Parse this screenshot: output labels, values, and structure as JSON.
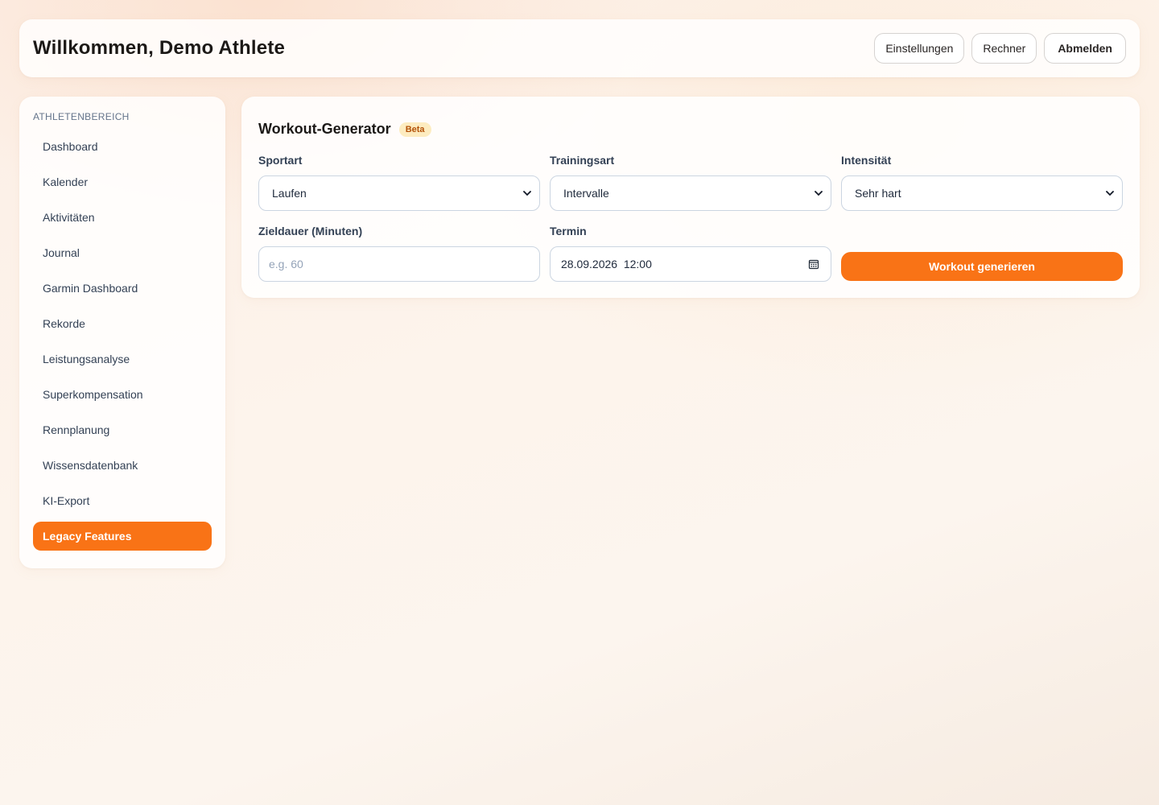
{
  "header": {
    "title": "Willkommen, Demo Athlete",
    "buttons": {
      "settings": "Einstellungen",
      "calculator": "Rechner",
      "logout": "Abmelden"
    }
  },
  "sidebar": {
    "heading": "ATHLETENBEREICH",
    "items": [
      {
        "label": "Dashboard"
      },
      {
        "label": "Kalender"
      },
      {
        "label": "Aktivitäten"
      },
      {
        "label": "Journal"
      },
      {
        "label": "Garmin Dashboard"
      },
      {
        "label": "Rekorde"
      },
      {
        "label": "Leistungsanalyse"
      },
      {
        "label": "Superkompensation"
      },
      {
        "label": "Rennplanung"
      },
      {
        "label": "Wissensdatenbank"
      },
      {
        "label": "KI-Export"
      },
      {
        "label": "Legacy Features",
        "active": true
      }
    ]
  },
  "generator": {
    "title": "Workout-Generator",
    "badge": "Beta",
    "sport": {
      "label": "Sportart",
      "value": "Laufen"
    },
    "training_type": {
      "label": "Trainingsart",
      "value": "Intervalle"
    },
    "intensity": {
      "label": "Intensität",
      "value": "Sehr hart"
    },
    "duration": {
      "label": "Zieldauer (Minuten)",
      "placeholder": "e.g. 60"
    },
    "appointment": {
      "label": "Termin",
      "value": "28.09.2026  12:00"
    },
    "generate_label": "Workout generieren"
  },
  "colors": {
    "accent": "#f97316",
    "badge_bg": "#fdecc0",
    "badge_text": "#b45309"
  },
  "icons": {
    "select": "chevron-down-icon",
    "date": "calendar-icon"
  }
}
